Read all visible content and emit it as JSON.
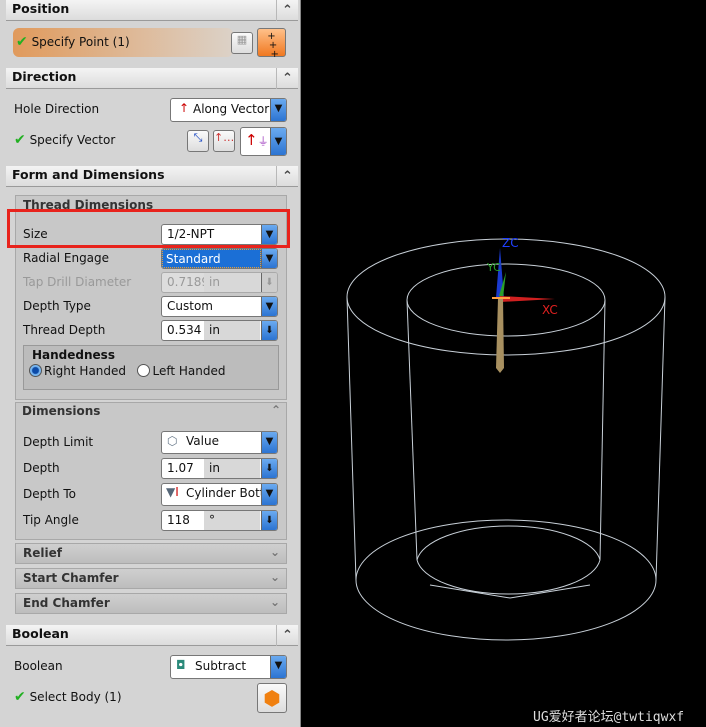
{
  "panel": {
    "position": {
      "title": "Position",
      "specify_point": "Specify Point (1)"
    },
    "direction": {
      "title": "Direction",
      "hole_direction_label": "Hole Direction",
      "hole_direction_value": "Along Vector",
      "specify_vector": "Specify Vector"
    },
    "form": {
      "title": "Form and Dimensions",
      "thread": {
        "title": "Thread Dimensions",
        "size_label": "Size",
        "size_value": "1/2-NPT",
        "radial_label": "Radial Engage",
        "radial_value": "Standard",
        "tap_label": "Tap Drill Diameter",
        "tap_value": "0.7189",
        "tap_unit": "in",
        "depth_type_label": "Depth Type",
        "depth_type_value": "Custom",
        "thread_depth_label": "Thread Depth",
        "thread_depth_value": "0.534",
        "thread_depth_unit": "in",
        "handedness_title": "Handedness",
        "right": "Right Handed",
        "left": "Left Handed",
        "selected": "Right Handed"
      },
      "dimensions": {
        "title": "Dimensions",
        "depth_limit_label": "Depth Limit",
        "depth_limit_value": "Value",
        "depth_label": "Depth",
        "depth_value": "1.07",
        "depth_unit": "in",
        "depth_to_label": "Depth To",
        "depth_to_value": "Cylinder Bott",
        "tip_label": "Tip Angle",
        "tip_value": "118",
        "tip_unit": "°"
      },
      "relief": "Relief",
      "start_chamfer": "Start Chamfer",
      "end_chamfer": "End Chamfer"
    },
    "boolean": {
      "title": "Boolean",
      "label": "Boolean",
      "value": "Subtract",
      "select_body": "Select Body (1)"
    }
  },
  "viewport": {
    "axes": {
      "z": "ZC",
      "y": "YC",
      "x": "XC"
    },
    "watermark": "UG爱好者论坛@twtiqwxf",
    "highlight_color": "#e8231c"
  }
}
